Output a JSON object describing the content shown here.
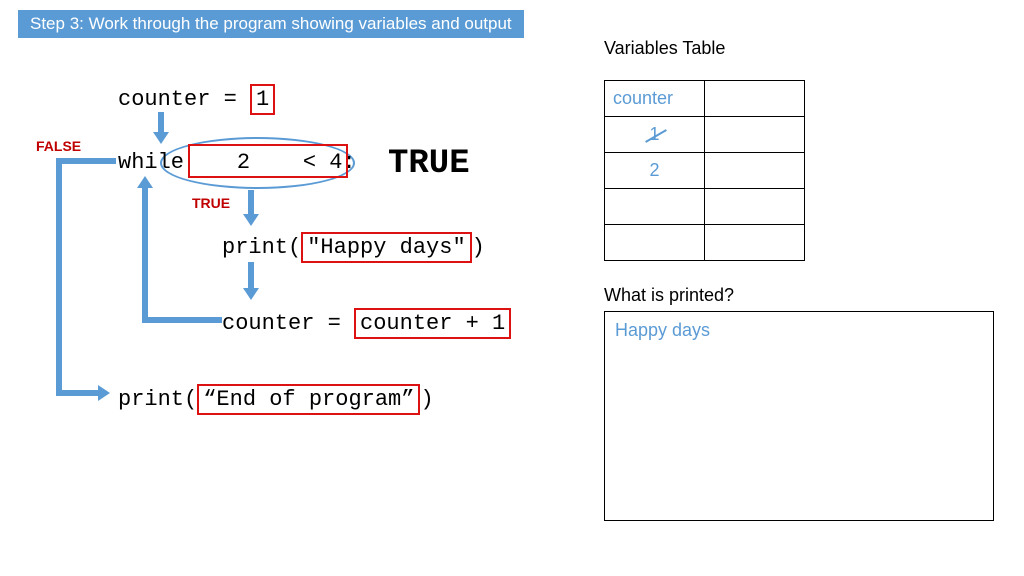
{
  "banner": "Step 3: Work through the program showing variables and output",
  "code": {
    "line1_a": "counter = ",
    "line1_b": "1",
    "line2_a": "while",
    "line2_cond_val": "2",
    "line2_cond_rest": "< 4:",
    "line2_result": "TRUE",
    "line3_a": "print(",
    "line3_b": "\"Happy days\"",
    "line3_c": ")",
    "line4_a": "counter = ",
    "line4_b": "counter + 1",
    "line5_a": "print(",
    "line5_b": "“End of program”",
    "line5_c": ")"
  },
  "labels": {
    "false": "FALSE",
    "true": "TRUE"
  },
  "var_title": "Variables Table",
  "var_table": {
    "header": "counter",
    "row1": "1",
    "row2": "2"
  },
  "printed_title": "What is printed?",
  "printed_lines": [
    "Happy days"
  ]
}
